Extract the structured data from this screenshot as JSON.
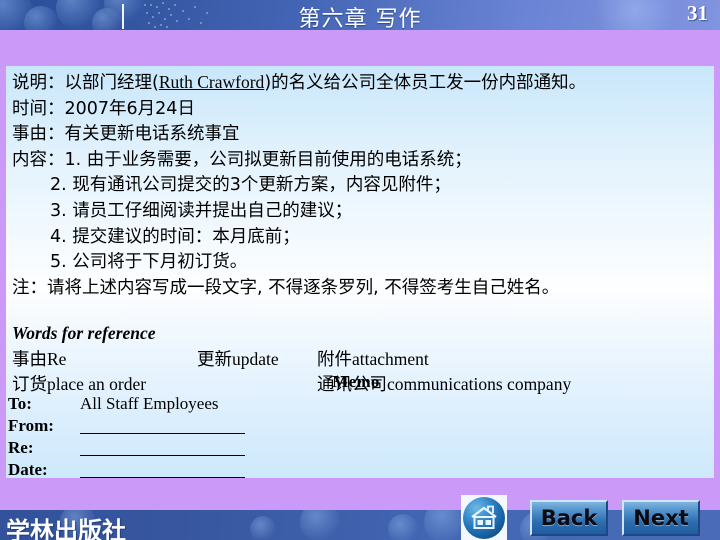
{
  "header": {
    "title": "第六章  写作",
    "page_number": "31",
    "colors": {
      "bar_left": "#2a4f9b",
      "bar_right": "#8194e0",
      "text": "#ffffff"
    }
  },
  "frame": {
    "border_color": "#cb99f7"
  },
  "body": {
    "lines": [
      {
        "label": "说明：",
        "text": "以部门经理(",
        "underlined": "Ruth Crawford",
        "text_after": ")的名义给公司全体员工发一份内部通知。",
        "indent": false
      },
      {
        "label": "时间：",
        "text": "2007年6月24日",
        "indent": false
      },
      {
        "label": "事由：",
        "text": "有关更新电话系统事宜",
        "indent": false
      },
      {
        "label": "内容：",
        "text": "1. 由于业务需要，公司拟更新目前使用的电话系统；",
        "indent": false
      },
      {
        "label": "",
        "text": "2. 现有通讯公司提交的3个更新方案，内容见附件；",
        "indent": true
      },
      {
        "label": "",
        "text": "3. 请员工仔细阅读并提出自己的建议；",
        "indent": true
      },
      {
        "label": "",
        "text": "4. 提交建议的时间：本月底前；",
        "indent": true
      },
      {
        "label": "",
        "text": "5. 公司将于下月初订货。",
        "indent": true
      },
      {
        "label": "",
        "text": "注：请将上述内容写成一段文字, 不得逐条罗列, 不得签考生自己姓名。",
        "indent": false
      }
    ]
  },
  "words_for_reference": {
    "title": "Words for reference",
    "entries": [
      {
        "cn": "事由",
        "en": "Re",
        "col": 1,
        "row": 1
      },
      {
        "cn": "更新",
        "en": "update",
        "col": 2,
        "row": 1
      },
      {
        "cn": "附件",
        "en": "attachment",
        "col": 3,
        "row": 1
      },
      {
        "cn": "订货",
        "en": "place an order",
        "col": 1,
        "row": 2
      },
      {
        "cn": "通讯公司",
        "en": "communications company",
        "col": 3,
        "row": 2
      }
    ],
    "row1": {
      "c1": "事由Re",
      "c2": "更新update",
      "c3": "附件attachment"
    },
    "row2": {
      "c1": "订货place an order",
      "c3": "通讯公司communications company"
    }
  },
  "memo": {
    "title": "Memo",
    "rows": [
      {
        "key": "To:",
        "value": "All Staff Employees",
        "blank": false
      },
      {
        "key": "From:",
        "value": "",
        "blank": true
      },
      {
        "key": "Re:",
        "value": "",
        "blank": true
      },
      {
        "key": "Date:",
        "value": "",
        "blank": true
      }
    ]
  },
  "footer": {
    "publisher": "学林出版社",
    "home_icon": "home-icon",
    "back_label": "Back",
    "next_label": "Next",
    "colors": {
      "bar": "#3a5aa3",
      "band": "#cb99f7",
      "button": "#2f6ead"
    }
  }
}
